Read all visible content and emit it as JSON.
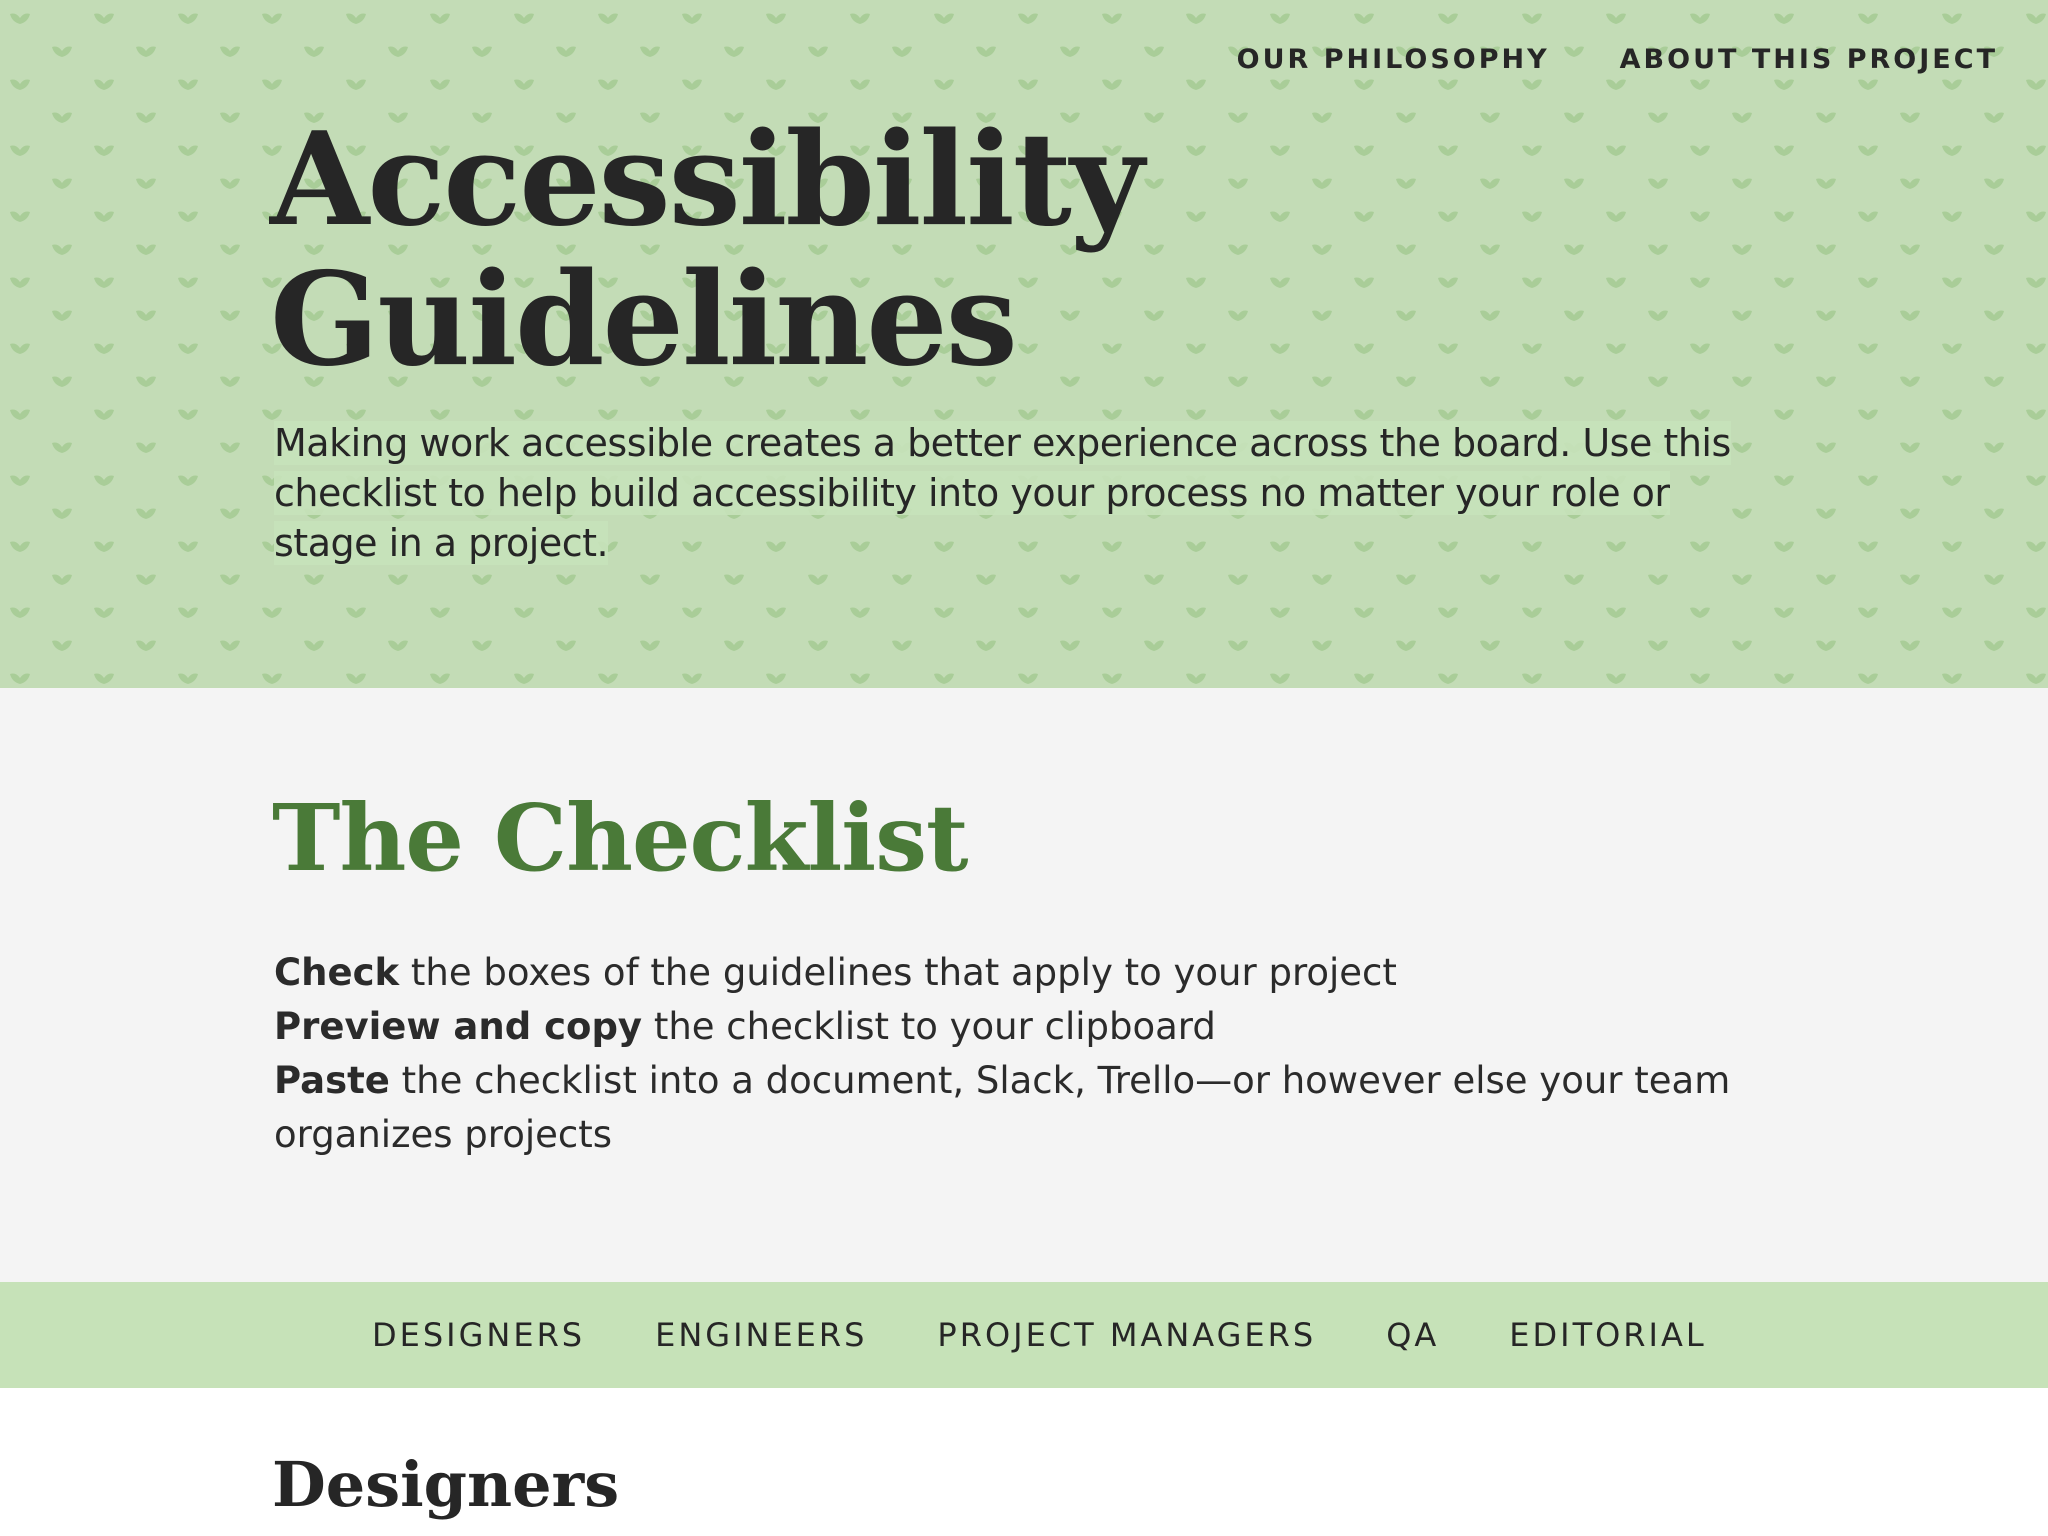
{
  "nav": {
    "items": [
      {
        "label": "OUR PHILOSOPHY"
      },
      {
        "label": "ABOUT THIS PROJECT"
      }
    ]
  },
  "hero": {
    "title_line1": "Accessibility",
    "title_line2": "Guidelines",
    "intro": "Making work accessible creates a better experience across the board. Use this checklist to help build accessibility into your process no matter your role or stage in a project."
  },
  "checklist": {
    "title": "The Checklist",
    "steps": [
      {
        "bold": "Check",
        "text": " the boxes of the guidelines that apply to your project"
      },
      {
        "bold": "Preview and copy",
        "text": " the checklist to your clipboard"
      },
      {
        "bold": "Paste",
        "text": " the checklist into a document, Slack, Trello—or however else your team organizes projects"
      }
    ]
  },
  "roles": {
    "tabs": [
      {
        "label": "DESIGNERS"
      },
      {
        "label": "ENGINEERS"
      },
      {
        "label": "PROJECT MANAGERS"
      },
      {
        "label": "QA"
      },
      {
        "label": "EDITORIAL"
      }
    ]
  },
  "designers": {
    "heading": "Designers"
  },
  "colors": {
    "hero_bg": "#c3dcb6",
    "pattern": "#a9cd98",
    "accent_green": "#4a7a38",
    "tab_bar_bg": "#c6e2b8",
    "intro_bg": "#f4f4f4",
    "text": "#262626"
  },
  "icons": {
    "hero_pattern": "leaf-sprout-icon"
  }
}
